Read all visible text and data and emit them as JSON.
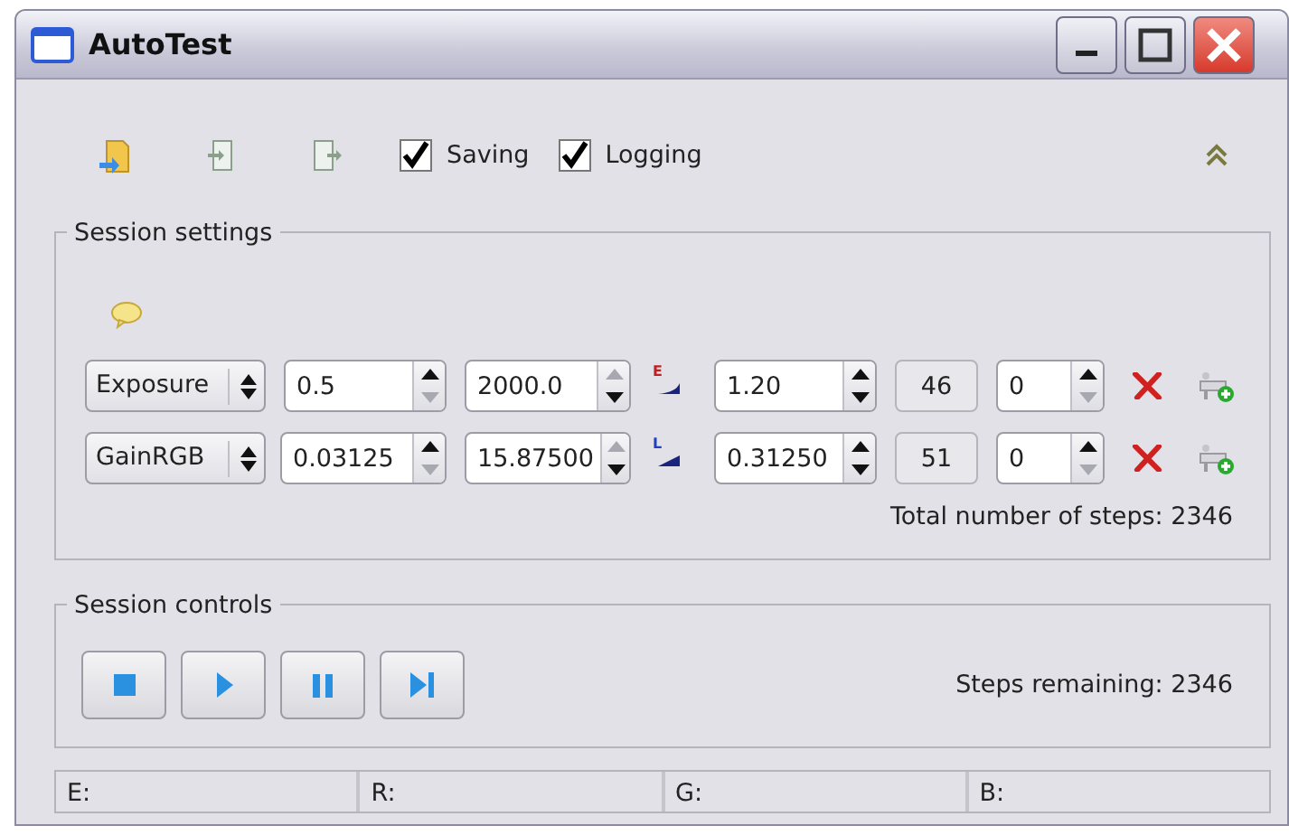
{
  "window": {
    "title": "AutoTest"
  },
  "toolbar": {
    "checkboxes": [
      {
        "label": "Saving",
        "checked": true
      },
      {
        "label": "Logging",
        "checked": true
      }
    ]
  },
  "session_settings": {
    "title": "Session settings",
    "parameters": [
      {
        "name": "Exposure",
        "start": {
          "value": "0.5",
          "up_disabled": false,
          "down_disabled": true
        },
        "end": {
          "value": "2000.0",
          "up_disabled": true,
          "down_disabled": false
        },
        "kind": "exponential",
        "scale_mark": "E",
        "step": {
          "value": "1.20",
          "up_disabled": false,
          "down_disabled": false
        },
        "count": "46",
        "offset": {
          "value": "0",
          "up_disabled": false,
          "down_disabled": true
        }
      },
      {
        "name": "GainRGB",
        "start": {
          "value": "0.03125",
          "up_disabled": false,
          "down_disabled": true
        },
        "end": {
          "value": "15.87500",
          "up_disabled": true,
          "down_disabled": false
        },
        "kind": "linear",
        "scale_mark": "L",
        "step": {
          "value": "0.31250",
          "up_disabled": false,
          "down_disabled": false
        },
        "count": "51",
        "offset": {
          "value": "0",
          "up_disabled": false,
          "down_disabled": true
        }
      }
    ],
    "total": "Total number of steps: 2346"
  },
  "session_controls": {
    "title": "Session controls",
    "steps_remaining": "Steps remaining: 2346"
  },
  "status_bar": [
    "E:",
    "R:",
    "G:",
    "B:"
  ]
}
